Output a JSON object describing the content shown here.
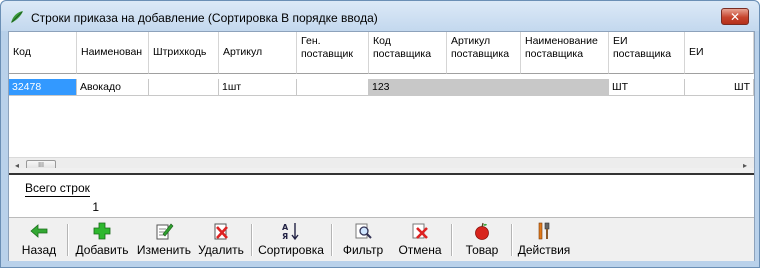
{
  "window": {
    "title": "Строки приказа на добавление (Сортировка В порядке ввода)",
    "close_label": "✕"
  },
  "grid": {
    "columns": [
      {
        "line1": "Код",
        "line2": ""
      },
      {
        "line1": "Наименован",
        "line2": ""
      },
      {
        "line1": "Штрихкодь",
        "line2": ""
      },
      {
        "line1": "Артикул",
        "line2": ""
      },
      {
        "line1": "Ген.",
        "line2": "поставщик"
      },
      {
        "line1": "Код",
        "line2": "поставщика"
      },
      {
        "line1": "Артикул",
        "line2": "поставщика"
      },
      {
        "line1": "Наименование",
        "line2": "поставщика"
      },
      {
        "line1": "ЕИ",
        "line2": "поставщика"
      },
      {
        "line1": "ЕИ",
        "line2": ""
      }
    ],
    "rows": [
      [
        "32478",
        "Авокадо",
        "",
        "1шт",
        "",
        "123",
        "",
        "",
        "ШТ",
        "ШТ"
      ]
    ]
  },
  "scrollbar": {
    "left_arrow": "◂",
    "right_arrow": "▸",
    "thumb_grip": "III"
  },
  "summary": {
    "label": "Всего строк",
    "value": "1"
  },
  "toolbar": {
    "back": "Назад",
    "add": "Добавить",
    "edit": "Изменить",
    "delete": "Удалить",
    "sort": "Сортировка",
    "filter": "Фильтр",
    "cancel": "Отмена",
    "product": "Товар",
    "actions": "Действия"
  },
  "colors": {
    "selection": "#3399ff",
    "title_bg": "#c3d8ee",
    "close": "#c7452e"
  }
}
